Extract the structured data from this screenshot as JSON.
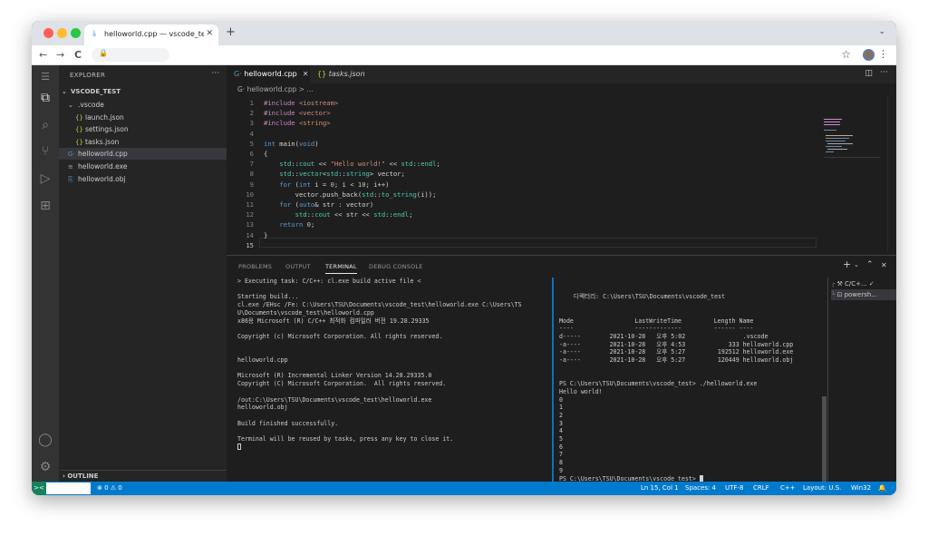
{
  "browser": {
    "tab_title": "helloworld.cpp — vscode_test",
    "tab_icon": "⫰",
    "close": "✕",
    "new_tab": "+",
    "back": "←",
    "forward": "→",
    "reload": "C",
    "lock": "🔒",
    "star": "☆",
    "menu": "⋮",
    "expand": "⌄"
  },
  "explorer": {
    "title": "EXPLORER",
    "more": "···",
    "root": "VSCODE_TEST",
    "items": [
      {
        "label": ".vscode",
        "icon": "⌄",
        "icon_color": "#cccccc"
      },
      {
        "label": "launch.json",
        "icon": "{}",
        "icon_color": "#cbcb41"
      },
      {
        "label": "settings.json",
        "icon": "{}",
        "icon_color": "#cbcb41"
      },
      {
        "label": "tasks.json",
        "icon": "{}",
        "icon_color": "#cbcb41"
      },
      {
        "label": "helloworld.cpp",
        "icon": "G·",
        "icon_color": "#519aba"
      },
      {
        "label": "helloworld.exe",
        "icon": "≡",
        "icon_color": "#a0a0a0"
      },
      {
        "label": "helloworld.obj",
        "icon": "⎘",
        "icon_color": "#519aba"
      }
    ],
    "outline": "OUTLINE"
  },
  "editor": {
    "tabs": [
      {
        "label": "helloworld.cpp",
        "icon": "G·",
        "close": "✕"
      },
      {
        "label": "tasks.json",
        "icon": "{}"
      }
    ],
    "breadcrumb": "G· helloworld.cpp > ...",
    "lines": [
      "#include <iostream>",
      "#include <vector>",
      "#include <string>",
      "",
      "int main(void)",
      "{",
      "    std::cout << \"Hello world!\" << std::endl;",
      "    std::vector<std::string> vector;",
      "    for (int i = 0; i < 10; i++)",
      "        vector.push_back(std::to_string(i));",
      "    for (auto& str : vector)",
      "        std::cout << str << std::endl;",
      "    return 0;",
      "}",
      ""
    ],
    "line_numbers": [
      "1",
      "2",
      "3",
      "4",
      "5",
      "6",
      "7",
      "8",
      "9",
      "10",
      "11",
      "12",
      "13",
      "14",
      "15"
    ]
  },
  "panel": {
    "tabs": [
      "PROBLEMS",
      "OUTPUT",
      "TERMINAL",
      "DEBUG CONSOLE"
    ],
    "actions": {
      "add": "+",
      "chevron": "⌄",
      "up": "⌃",
      "close": "✕"
    },
    "terminal_left": "> Executing task: C/C++: cl.exe build active file <\n\nStarting build...\ncl.exe /EHsc /Fe: C:\\Users\\TSU\\Documents\\vscode_test\\helloworld.exe C:\\Users\\TS\nU\\Documents\\vscode_test\\helloworld.cpp\nx86용 Microsoft (R) C/C++ 최적화 컴파일러 버전 19.28.29335\n\nCopyright (c) Microsoft Corporation. All rights reserved.\n\n\nhelloworld.cpp\n\nMicrosoft (R) Incremental Linker Version 14.28.29335.0\nCopyright (C) Microsoft Corporation.  All rights reserved.\n\n/out:C:\\Users\\TSU\\Documents\\vscode_test\\helloworld.exe\nhelloworld.obj\n\nBuild finished successfully.\n\nTerminal will be reused by tasks, press any key to close it.",
    "terminal_right": "\n\n    디렉터리: C:\\Users\\TSU\\Documents\\vscode_test\n\n\nMode                 LastWriteTime         Length Name\n----                 -------------         ------ ----\nd-----        2021-10-28   오후 5:02                .vscode\n-a----        2021-10-28   오후 4:53            333 helloworld.cpp\n-a----        2021-10-28   오후 5:27         192512 helloworld.exe\n-a----        2021-10-28   오후 5:27         120449 helloworld.obj\n\n\nPS C:\\Users\\TSU\\Documents\\vscode_test> ./helloworld.exe\nHello world!\n0\n1\n2\n3\n4\n5\n6\n7\n8\n9\nPS C:\\Users\\TSU\\Documents\\vscode_test> ",
    "terminal_list": [
      "C/C+...",
      "powersh..."
    ],
    "check": "✓"
  },
  "statusbar": {
    "remote": "><",
    "problems": "⊗ 0 ⚠ 0",
    "position": "Ln 15, Col 1",
    "spaces": "Spaces: 4",
    "encoding": "UTF-8",
    "eol": "CRLF",
    "language": "C++",
    "layout": "Layout: U.S.",
    "platform": "Win32",
    "bell": "🔔"
  },
  "colors": {
    "accent": "#007acc",
    "keyword": "#569cd6",
    "string": "#ce9178",
    "include": "#c586c0",
    "type": "#4ec9b0"
  }
}
